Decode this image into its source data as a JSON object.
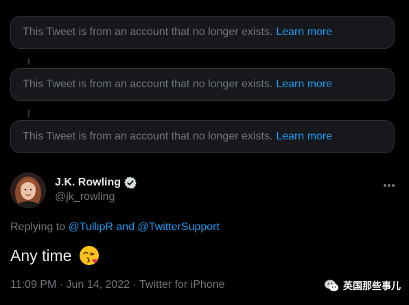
{
  "deleted_notices": [
    {
      "text": "This Tweet is from an account that no longer exists.",
      "link": "Learn more"
    },
    {
      "text": "This Tweet is from an account that no longer exists.",
      "link": "Learn more"
    },
    {
      "text": "This Tweet is from an account that no longer exists.",
      "link": "Learn more"
    }
  ],
  "author": {
    "name": "J.K. Rowling",
    "handle": "@jk_rowling",
    "verified": true
  },
  "reply": {
    "prefix": "Replying to",
    "mention1": "@TullipR",
    "joiner": "and",
    "mention2": "@TwitterSupport"
  },
  "tweet": {
    "text": "Any time",
    "emoji": "kissing-face-with-heart-icon"
  },
  "meta": {
    "time": "11:09 PM",
    "date": "Jun 14, 2022",
    "source": "Twitter for iPhone"
  },
  "watermark": {
    "text": "英国那些事儿"
  },
  "colors": {
    "accent": "#1d9bf0",
    "muted": "#71767b",
    "text": "#e7e9ea",
    "background": "#000000"
  }
}
